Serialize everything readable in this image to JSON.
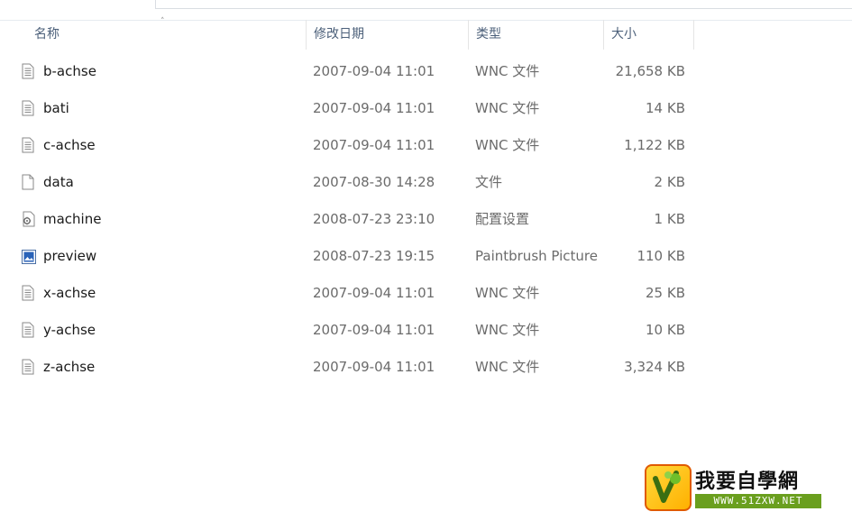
{
  "columns": {
    "name": "名称",
    "date": "修改日期",
    "type": "类型",
    "size": "大小"
  },
  "sort": {
    "column": "name",
    "direction": "ascending",
    "icon": "sort-up-arrow-icon"
  },
  "files": [
    {
      "name": "b-achse",
      "date": "2007-09-04 11:01",
      "type": "WNC 文件",
      "size": "21,658 KB",
      "icon": "text-file-icon"
    },
    {
      "name": "bati",
      "date": "2007-09-04 11:01",
      "type": "WNC 文件",
      "size": "14 KB",
      "icon": "text-file-icon"
    },
    {
      "name": "c-achse",
      "date": "2007-09-04 11:01",
      "type": "WNC 文件",
      "size": "1,122 KB",
      "icon": "text-file-icon"
    },
    {
      "name": "data",
      "date": "2007-08-30 14:28",
      "type": "文件",
      "size": "2 KB",
      "icon": "blank-file-icon"
    },
    {
      "name": "machine",
      "date": "2008-07-23 23:10",
      "type": "配置设置",
      "size": "1 KB",
      "icon": "settings-file-icon"
    },
    {
      "name": "preview",
      "date": "2008-07-23 19:15",
      "type": "Paintbrush Picture",
      "size": "110 KB",
      "icon": "picture-file-icon"
    },
    {
      "name": "x-achse",
      "date": "2007-09-04 11:01",
      "type": "WNC 文件",
      "size": "25 KB",
      "icon": "text-file-icon"
    },
    {
      "name": "y-achse",
      "date": "2007-09-04 11:01",
      "type": "WNC 文件",
      "size": "10 KB",
      "icon": "text-file-icon"
    },
    {
      "name": "z-achse",
      "date": "2007-09-04 11:01",
      "type": "WNC 文件",
      "size": "3,324 KB",
      "icon": "text-file-icon"
    }
  ],
  "watermark": {
    "title": "我要自學網",
    "url": "WWW.51ZXW.NET",
    "colors": {
      "logo_fill": "#ffc21a",
      "logo_border": "#e05a00",
      "url_bar": "#6a9f1e"
    }
  }
}
